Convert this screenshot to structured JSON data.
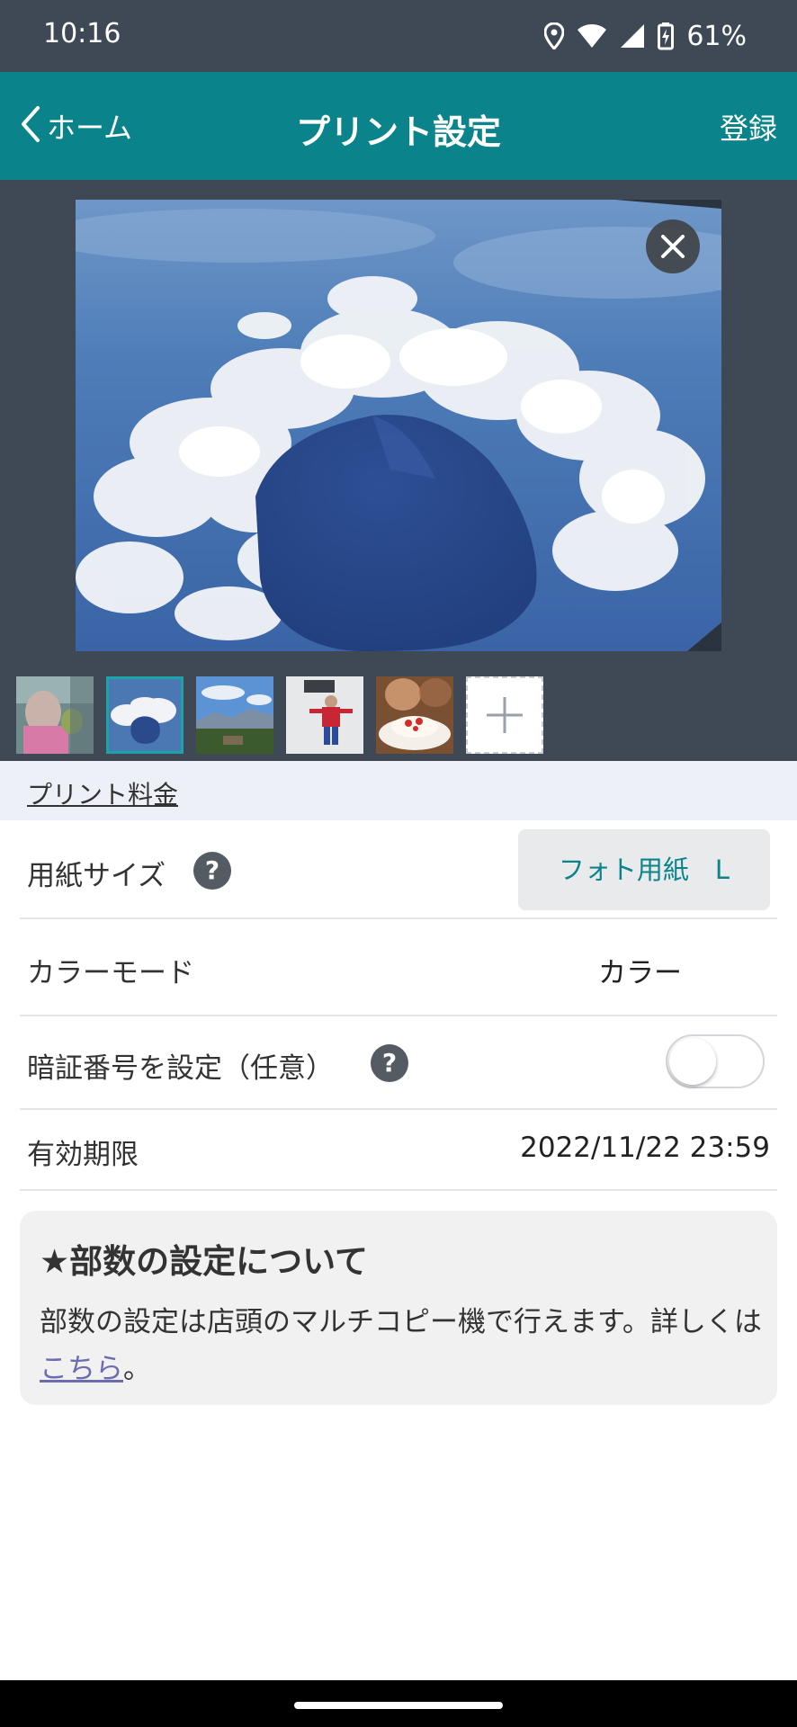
{
  "status_bar": {
    "time": "10:16",
    "battery_percent": "61%",
    "icons": [
      "location-icon",
      "wifi-icon",
      "cell-signal-icon",
      "battery-charging-icon"
    ]
  },
  "header": {
    "back_label": "ホーム",
    "title": "プリント設定",
    "action_label": "登録",
    "background_color": "#0a848a"
  },
  "preview": {
    "remove_icon": "close-icon",
    "selected_thumbnail_index": 1,
    "thumbnails": [
      {
        "name": "thumbnail-child-with-bird"
      },
      {
        "name": "thumbnail-mountain-clouds"
      },
      {
        "name": "thumbnail-landscape"
      },
      {
        "name": "thumbnail-child-snow"
      },
      {
        "name": "thumbnail-cake"
      }
    ],
    "add_icon": "plus-icon"
  },
  "price_section": {
    "label": "プリント料金"
  },
  "settings": {
    "paper_size": {
      "label": "用紙サイズ",
      "value": "フォト用紙　L"
    },
    "color_mode": {
      "label": "カラーモード",
      "value": "カラー"
    },
    "pin": {
      "label": "暗証番号を設定（任意）",
      "enabled": false
    },
    "expiry": {
      "label": "有効期限",
      "value": "2022/11/22 23:59"
    },
    "help_icon_glyph": "?"
  },
  "info": {
    "title": "★部数の設定について",
    "body": "部数の設定は店頭のマルチコピー機で行えます。詳しくは",
    "link_text": "こちら",
    "suffix": "。"
  }
}
